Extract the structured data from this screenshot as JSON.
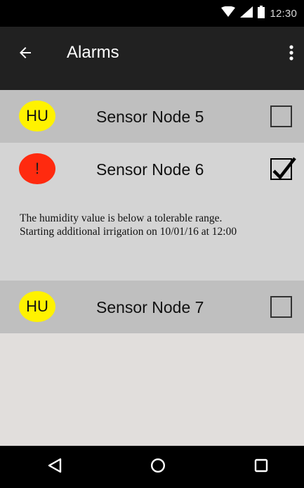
{
  "status_bar": {
    "time": "12:30",
    "icons": [
      "wifi-icon",
      "signal-icon",
      "battery-icon"
    ]
  },
  "app_bar": {
    "title": "Alarms",
    "back_icon": "arrow-left-icon",
    "menu_icon": "more-vertical-icon"
  },
  "alarms": [
    {
      "badge": "HU",
      "badge_color": "#fff200",
      "label": "Sensor Node 5",
      "checked": false
    },
    {
      "badge": "!",
      "badge_color": "#ff2a0f",
      "label": "Sensor Node 6",
      "checked": true,
      "detail": [
        "The humidity value is below a tolerable range.",
        "Starting additional irrigation on 10/01/16 at 12:00"
      ]
    },
    {
      "badge": "HU",
      "badge_color": "#fff200",
      "label": "Sensor Node 7",
      "checked": false
    }
  ],
  "colors": {
    "app_bar": "#212121",
    "row_collapsed": "#bfbfbf",
    "row_expanded": "#d4d4d4",
    "background": "#e1dedc"
  },
  "nav_bar": {
    "icons": [
      "back-triangle-icon",
      "home-circle-icon",
      "recents-square-icon"
    ]
  }
}
